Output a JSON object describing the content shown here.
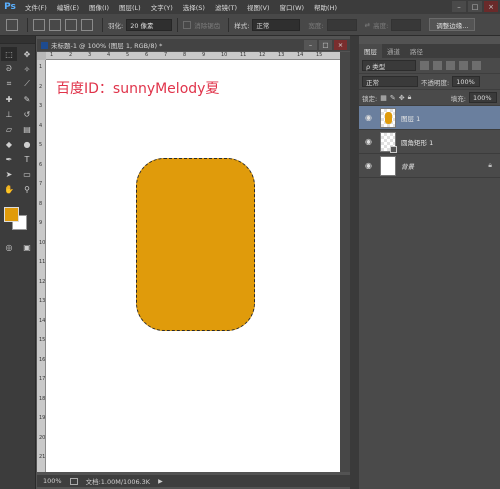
{
  "app": {
    "logo": "Ps"
  },
  "menu": [
    "文件(F)",
    "编辑(E)",
    "图像(I)",
    "图层(L)",
    "文字(Y)",
    "选择(S)",
    "滤镜(T)",
    "视图(V)",
    "窗口(W)",
    "帮助(H)"
  ],
  "window_controls": [
    "–",
    "□",
    "×"
  ],
  "options": {
    "feather_label": "羽化:",
    "feather_value": "20 像素",
    "antialias_label": "消除锯齿",
    "style_label": "样式:",
    "style_value": "正常",
    "width_label": "宽度:",
    "height_label": "高度:",
    "refine_button": "调整边缘..."
  },
  "document": {
    "tab_title": "未标题-1 @ 100% (图层 1, RGB/8) *",
    "controls": [
      "–",
      "□",
      "×"
    ],
    "canvas_text": "百度ID：sunnyMelody夏",
    "status_zoom": "100%",
    "status_doc": "文档:1.00M/1006.3K",
    "ruler_top": [
      "1",
      "2",
      "3",
      "4",
      "5",
      "6",
      "7",
      "8",
      "9",
      "10",
      "11",
      "12",
      "13",
      "14",
      "15"
    ],
    "ruler_left": [
      "1",
      "2",
      "3",
      "4",
      "5",
      "6",
      "7",
      "8",
      "9",
      "10",
      "11",
      "12",
      "13",
      "14",
      "15",
      "16",
      "17",
      "18",
      "19",
      "20",
      "21"
    ]
  },
  "layers_panel": {
    "tabs": [
      "图层",
      "通道",
      "路径"
    ],
    "filter_value": "ρ 类型",
    "blend_mode": "正常",
    "opacity_label": "不透明度:",
    "opacity_value": "100%",
    "lock_label": "锁定:",
    "fill_label": "填充:",
    "fill_value": "100%",
    "layers": [
      {
        "name": "图层 1",
        "selected": true
      },
      {
        "name": "圆角矩形 1",
        "selected": false
      },
      {
        "name": "背景",
        "selected": false
      }
    ]
  },
  "colors": {
    "accent": "#e09b0b",
    "foreground": "#e09b0b",
    "background": "#ffffff",
    "canvas_text": "#e0334a",
    "selected_layer": "#6a7f9e"
  }
}
